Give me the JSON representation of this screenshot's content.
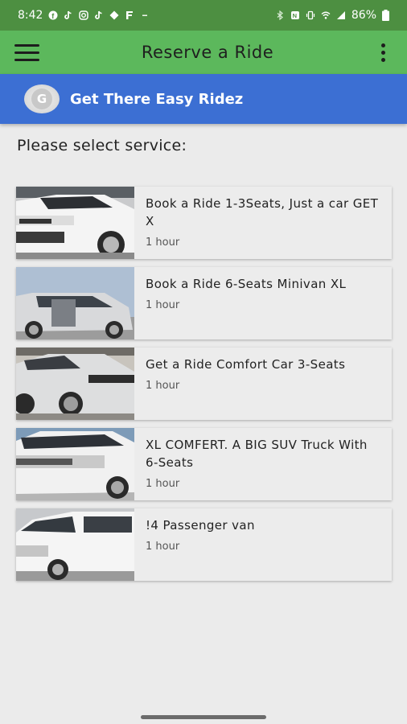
{
  "status_bar": {
    "time": "8:42",
    "battery": "86%"
  },
  "app_bar": {
    "title": "Reserve a Ride"
  },
  "brand": {
    "name": "Get There Easy Ridez",
    "logo_letter": "G"
  },
  "page": {
    "prompt": "Please select service:"
  },
  "services": [
    {
      "title": "Book a Ride 1-3Seats, Just a car GET X",
      "duration": "1 hour",
      "vehicle": "white compact SUV"
    },
    {
      "title": "Book a Ride 6-Seats Minivan XL",
      "duration": "1 hour",
      "vehicle": "silver minivan"
    },
    {
      "title": "Get a Ride Comfort Car 3-Seats",
      "duration": "1 hour",
      "vehicle": "silver crossover SUV"
    },
    {
      "title": "XL COMFERT. A BIG SUV Truck With 6-Seats",
      "duration": "1 hour",
      "vehicle": "white large SUV"
    },
    {
      "title": "!4 Passenger van",
      "duration": "1 hour",
      "vehicle": "white passenger van"
    }
  ],
  "colors": {
    "status_bar": "#4d8f41",
    "app_bar": "#5cb85c",
    "brand_bar": "#3c6fd3",
    "background": "#ebebeb"
  }
}
